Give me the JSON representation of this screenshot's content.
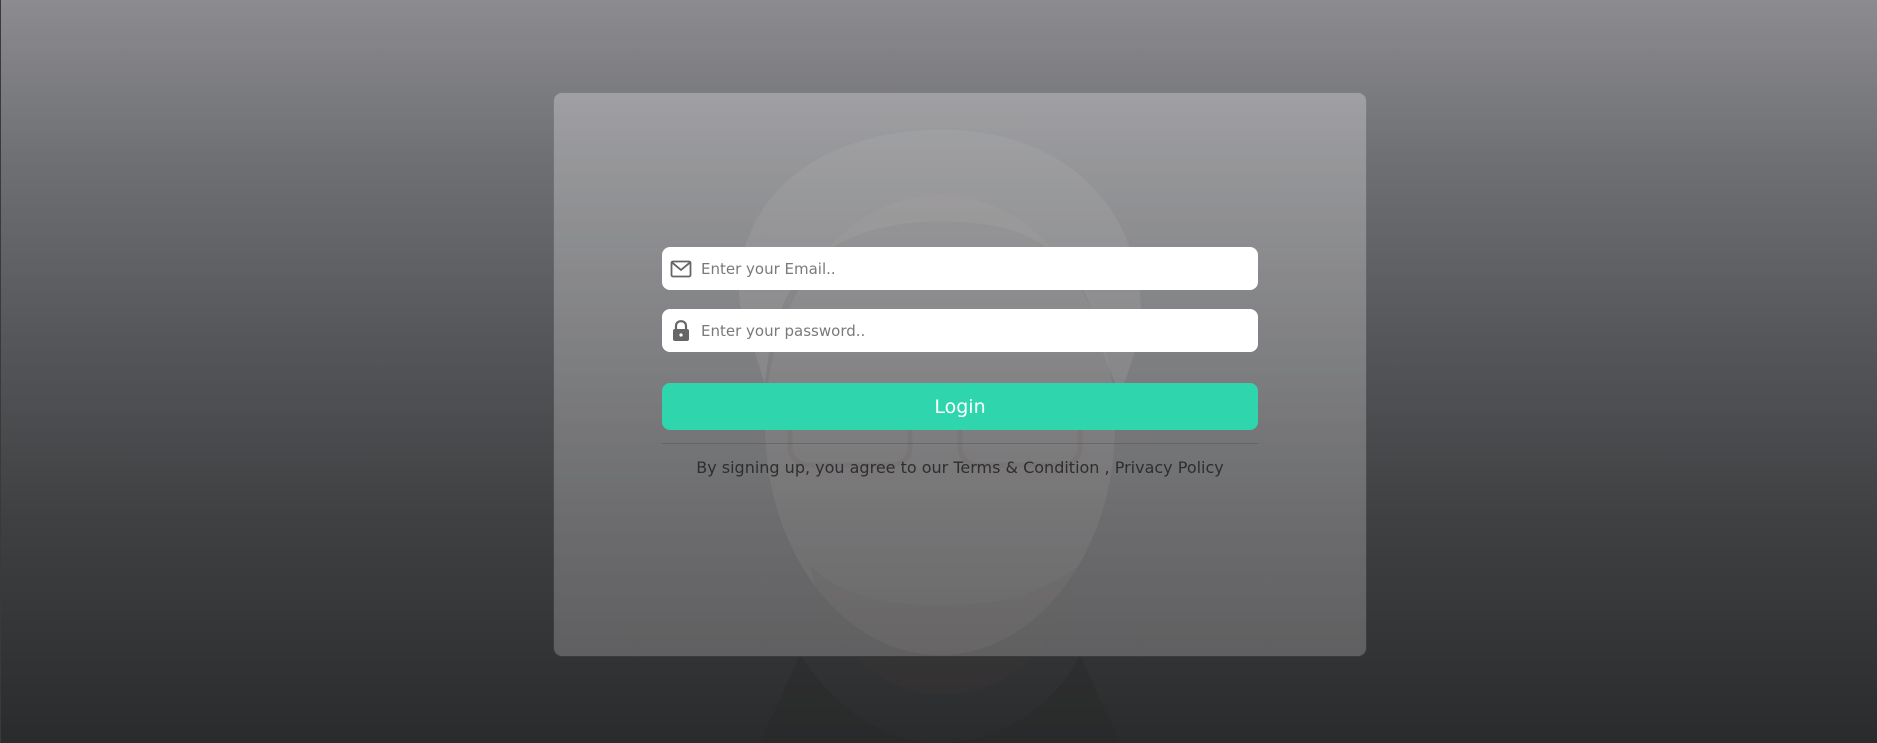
{
  "login_form": {
    "email_placeholder": "Enter your Email..",
    "password_placeholder": "Enter your password..",
    "login_label": "Login",
    "agreement_prefix": "By signing up, you agree to our ",
    "terms_link": "Terms & Condition",
    "separator": " , ",
    "privacy_link": "Privacy Policy",
    "email_icon": "envelope-icon",
    "password_icon": "lock-icon"
  },
  "colors": {
    "accent": "#2fd6ad",
    "field_background": "#ffffff",
    "text": "#2e2e2e"
  }
}
